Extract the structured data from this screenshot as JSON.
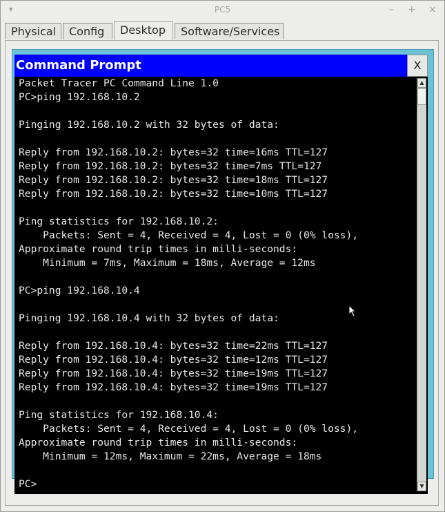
{
  "window": {
    "title": "PC5",
    "buttons": {
      "menu": "▾",
      "minimize": "–",
      "maximize": "+",
      "close": "×"
    }
  },
  "tabs": [
    {
      "label": "Physical"
    },
    {
      "label": "Config"
    },
    {
      "label": "Desktop"
    },
    {
      "label": "Software/Services"
    }
  ],
  "command_prompt": {
    "title": "Command Prompt",
    "close_label": "X",
    "lines": [
      "Packet Tracer PC Command Line 1.0",
      "PC>ping 192.168.10.2",
      "",
      "Pinging 192.168.10.2 with 32 bytes of data:",
      "",
      "Reply from 192.168.10.2: bytes=32 time=16ms TTL=127",
      "Reply from 192.168.10.2: bytes=32 time=7ms TTL=127",
      "Reply from 192.168.10.2: bytes=32 time=18ms TTL=127",
      "Reply from 192.168.10.2: bytes=32 time=10ms TTL=127",
      "",
      "Ping statistics for 192.168.10.2:",
      "    Packets: Sent = 4, Received = 4, Lost = 0 (0% loss),",
      "Approximate round trip times in milli-seconds:",
      "    Minimum = 7ms, Maximum = 18ms, Average = 12ms",
      "",
      "PC>ping 192.168.10.4",
      "",
      "Pinging 192.168.10.4 with 32 bytes of data:",
      "",
      "Reply from 192.168.10.4: bytes=32 time=22ms TTL=127",
      "Reply from 192.168.10.4: bytes=32 time=12ms TTL=127",
      "Reply from 192.168.10.4: bytes=32 time=19ms TTL=127",
      "Reply from 192.168.10.4: bytes=32 time=19ms TTL=127",
      "",
      "Ping statistics for 192.168.10.4:",
      "    Packets: Sent = 4, Received = 4, Lost = 0 (0% loss),",
      "Approximate round trip times in milli-seconds:",
      "    Minimum = 12ms, Maximum = 22ms, Average = 18ms",
      "",
      "PC>"
    ]
  },
  "colors": {
    "title_bar": "#0000ff",
    "terminal_bg": "#000000",
    "terminal_text": "#e8e8e8",
    "frame": "#6cc3d8"
  }
}
